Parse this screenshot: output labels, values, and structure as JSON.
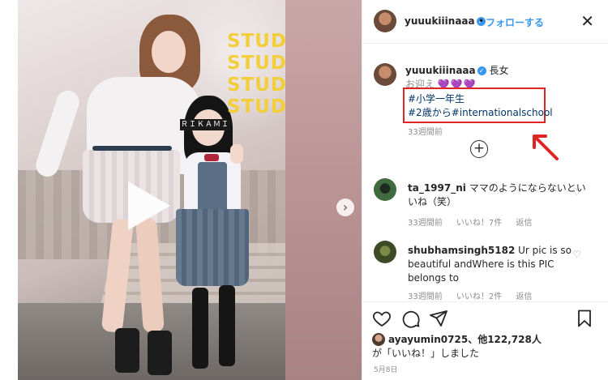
{
  "post": {
    "video_text": [
      "STUDY",
      "STUDY",
      "STUDY",
      "STUDY"
    ],
    "blur_label": "ＲＩＫＡＭＩ",
    "play_icon": "play-icon",
    "next_icon": "chevron-right-icon"
  },
  "header": {
    "username": "yuuukiiinaaa",
    "dot": "•",
    "follow_label": "フォローする",
    "close_icon": "close-icon"
  },
  "caption": {
    "username": "yuuukiiinaaa",
    "line1_suffix": "長女",
    "line2_prefix": "お迎え",
    "hearts": "💜💜💜",
    "hashtag1": "#小学一年生",
    "hashtag2_prefix": "#2歳から",
    "hashtag2_tag": "#internationalschool",
    "time": "33週間前"
  },
  "comments": [
    {
      "username": "ta_1997_ni",
      "text": "ママのようにならないといいね（笑）",
      "time": "33週間前",
      "likes": "いいね！7件",
      "reply": "返信"
    },
    {
      "username": "shubhamsingh5182",
      "text": "Ur pic is so beautiful andWhere is this PIC belongs to",
      "time": "33週間前",
      "likes": "いいね！2件",
      "reply": "返信"
    }
  ],
  "actions": {
    "like_icon": "heart-icon",
    "comment_icon": "comment-icon",
    "share_icon": "share-icon",
    "save_icon": "bookmark-icon"
  },
  "likes": {
    "user": "ayayumin0725",
    "others": "、他122,728人",
    "suffix": "が「いいね！」しました"
  },
  "date": "5月8日",
  "colors": {
    "link_blue": "#3897f0",
    "hashtag": "#003569",
    "highlight_red": "#e02424",
    "study_yellow": "#f2cf3a"
  }
}
